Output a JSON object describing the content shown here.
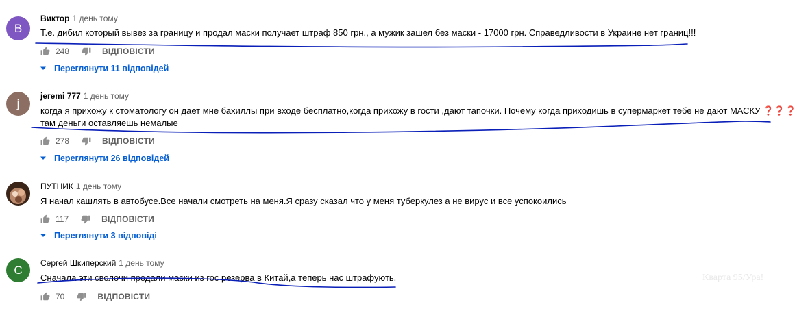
{
  "colors": {
    "link": "#065fd4",
    "meta": "#606060",
    "text": "#030303",
    "scribble": "#0a1fb8"
  },
  "watermark": "Кварта 95/Ура!",
  "comments": [
    {
      "avatar_letter": "В",
      "avatar_color": "#7e57c2",
      "author": "Виктор",
      "time": "1 день тому",
      "text_lines": [
        "Т.е. дибил который вывез за границу и продал маски получает штраф 850 грн., а мужик зашел без маски - 17000 грн. Справедливости в Украине нет границ!!!"
      ],
      "likes": "248",
      "reply_label": "ВІДПОВІСТИ",
      "view_replies": "Переглянути 11 відповідей"
    },
    {
      "avatar_letter": "j",
      "avatar_color": "#8d6e63",
      "author": "jeremi 777",
      "time": "1 день тому",
      "text_lines": [
        "когда я прихожу к стоматологу он дает мне бахиллы при входе бесплатно,когда прихожу в гости ,дают тапочки. Почему когда приходишь в супермаркет тебе не дают МАСКУ ❓❓❓",
        "там деньги оставляешь немалые"
      ],
      "likes": "278",
      "reply_label": "ВІДПОВІСТИ",
      "view_replies": "Переглянути 26 відповідей"
    },
    {
      "avatar_letter": "",
      "avatar_color": "#5a3a2c",
      "author": "ПУТНИК",
      "time": "1 день тому",
      "text_lines": [
        "Я начал кашлять в автобусе.Все начали смотреть на меня.Я сразу сказал что у меня туберкулез а не вирус и все успокоились"
      ],
      "likes": "117",
      "reply_label": "ВІДПОВІСТИ",
      "view_replies": "Переглянути 3 відповіді"
    },
    {
      "avatar_letter": "С",
      "avatar_color": "#2e7d32",
      "author": "Сергей Шкиперский",
      "time": "1 день тому",
      "text_lines": [
        "Сначала эти сволочи продали маски из гос резерва в Китай,а теперь нас штрафують."
      ],
      "likes": "70",
      "reply_label": "ВІДПОВІСТИ",
      "view_replies": ""
    }
  ]
}
